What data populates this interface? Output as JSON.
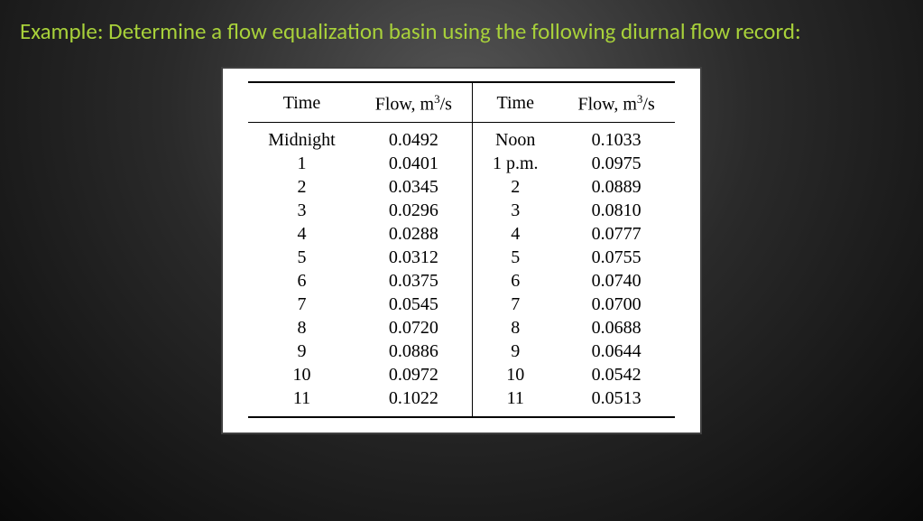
{
  "heading": {
    "example_label": "Example:",
    "text": " Determine a flow equalization basin using the following diurnal flow record:"
  },
  "table": {
    "headers": {
      "time1": "Time",
      "flow1_prefix": "Flow, m",
      "flow1_exp": "3",
      "flow1_suffix": "/s",
      "time2": "Time",
      "flow2_prefix": "Flow, m",
      "flow2_exp": "3",
      "flow2_suffix": "/s"
    },
    "rows": [
      {
        "t1": "Midnight",
        "f1": "0.0492",
        "t2": "Noon",
        "f2": "0.1033"
      },
      {
        "t1": "1",
        "f1": "0.0401",
        "t2": "1 p.m.",
        "f2": "0.0975"
      },
      {
        "t1": "2",
        "f1": "0.0345",
        "t2": "2",
        "f2": "0.0889"
      },
      {
        "t1": "3",
        "f1": "0.0296",
        "t2": "3",
        "f2": "0.0810"
      },
      {
        "t1": "4",
        "f1": "0.0288",
        "t2": "4",
        "f2": "0.0777"
      },
      {
        "t1": "5",
        "f1": "0.0312",
        "t2": "5",
        "f2": "0.0755"
      },
      {
        "t1": "6",
        "f1": "0.0375",
        "t2": "6",
        "f2": "0.0740"
      },
      {
        "t1": "7",
        "f1": "0.0545",
        "t2": "7",
        "f2": "0.0700"
      },
      {
        "t1": "8",
        "f1": "0.0720",
        "t2": "8",
        "f2": "0.0688"
      },
      {
        "t1": "9",
        "f1": "0.0886",
        "t2": "9",
        "f2": "0.0644"
      },
      {
        "t1": "10",
        "f1": "0.0972",
        "t2": "10",
        "f2": "0.0542"
      },
      {
        "t1": "11",
        "f1": "0.1022",
        "t2": "11",
        "f2": "0.0513"
      }
    ]
  }
}
